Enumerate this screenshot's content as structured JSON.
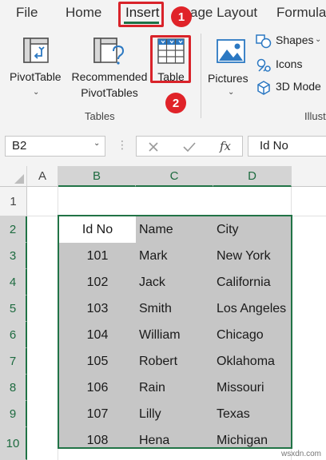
{
  "tabs": {
    "file": "File",
    "home": "Home",
    "insert": "Insert",
    "page_layout": "age Layout",
    "formulas": "Formula"
  },
  "ribbon": {
    "pivottable": "PivotTable",
    "recommended_line1": "Recommended",
    "recommended_line2": "PivotTables",
    "table": "Table",
    "tables_group": "Tables",
    "pictures": "Pictures",
    "shapes": "Shapes",
    "icons": "Icons",
    "models_3d": "3D Mode",
    "illustrations_group": "Illust"
  },
  "annotations": {
    "step1": "1",
    "step2": "2"
  },
  "formula_bar": {
    "name_box": "B2",
    "content": "Id No",
    "fx": "fx"
  },
  "columns": [
    "A",
    "B",
    "C",
    "D"
  ],
  "rows": [
    "1",
    "2",
    "3",
    "4",
    "5",
    "6",
    "7",
    "8",
    "9",
    "10"
  ],
  "table": {
    "headers": [
      "Id No",
      "Name",
      "City"
    ],
    "rows": [
      [
        "101",
        "Mark",
        "New York"
      ],
      [
        "102",
        "Jack",
        "California"
      ],
      [
        "103",
        "Smith",
        "Los Angeles"
      ],
      [
        "104",
        "William",
        "Chicago"
      ],
      [
        "105",
        "Robert",
        "Oklahoma"
      ],
      [
        "106",
        "Rain",
        "Missouri"
      ],
      [
        "107",
        "Lilly",
        "Texas"
      ],
      [
        "108",
        "Hena",
        "Michigan"
      ]
    ]
  },
  "watermark": "wsxdn.com",
  "colors": {
    "accent": "#217346",
    "highlight": "#d9232a",
    "selection": "#c6c6c6"
  }
}
